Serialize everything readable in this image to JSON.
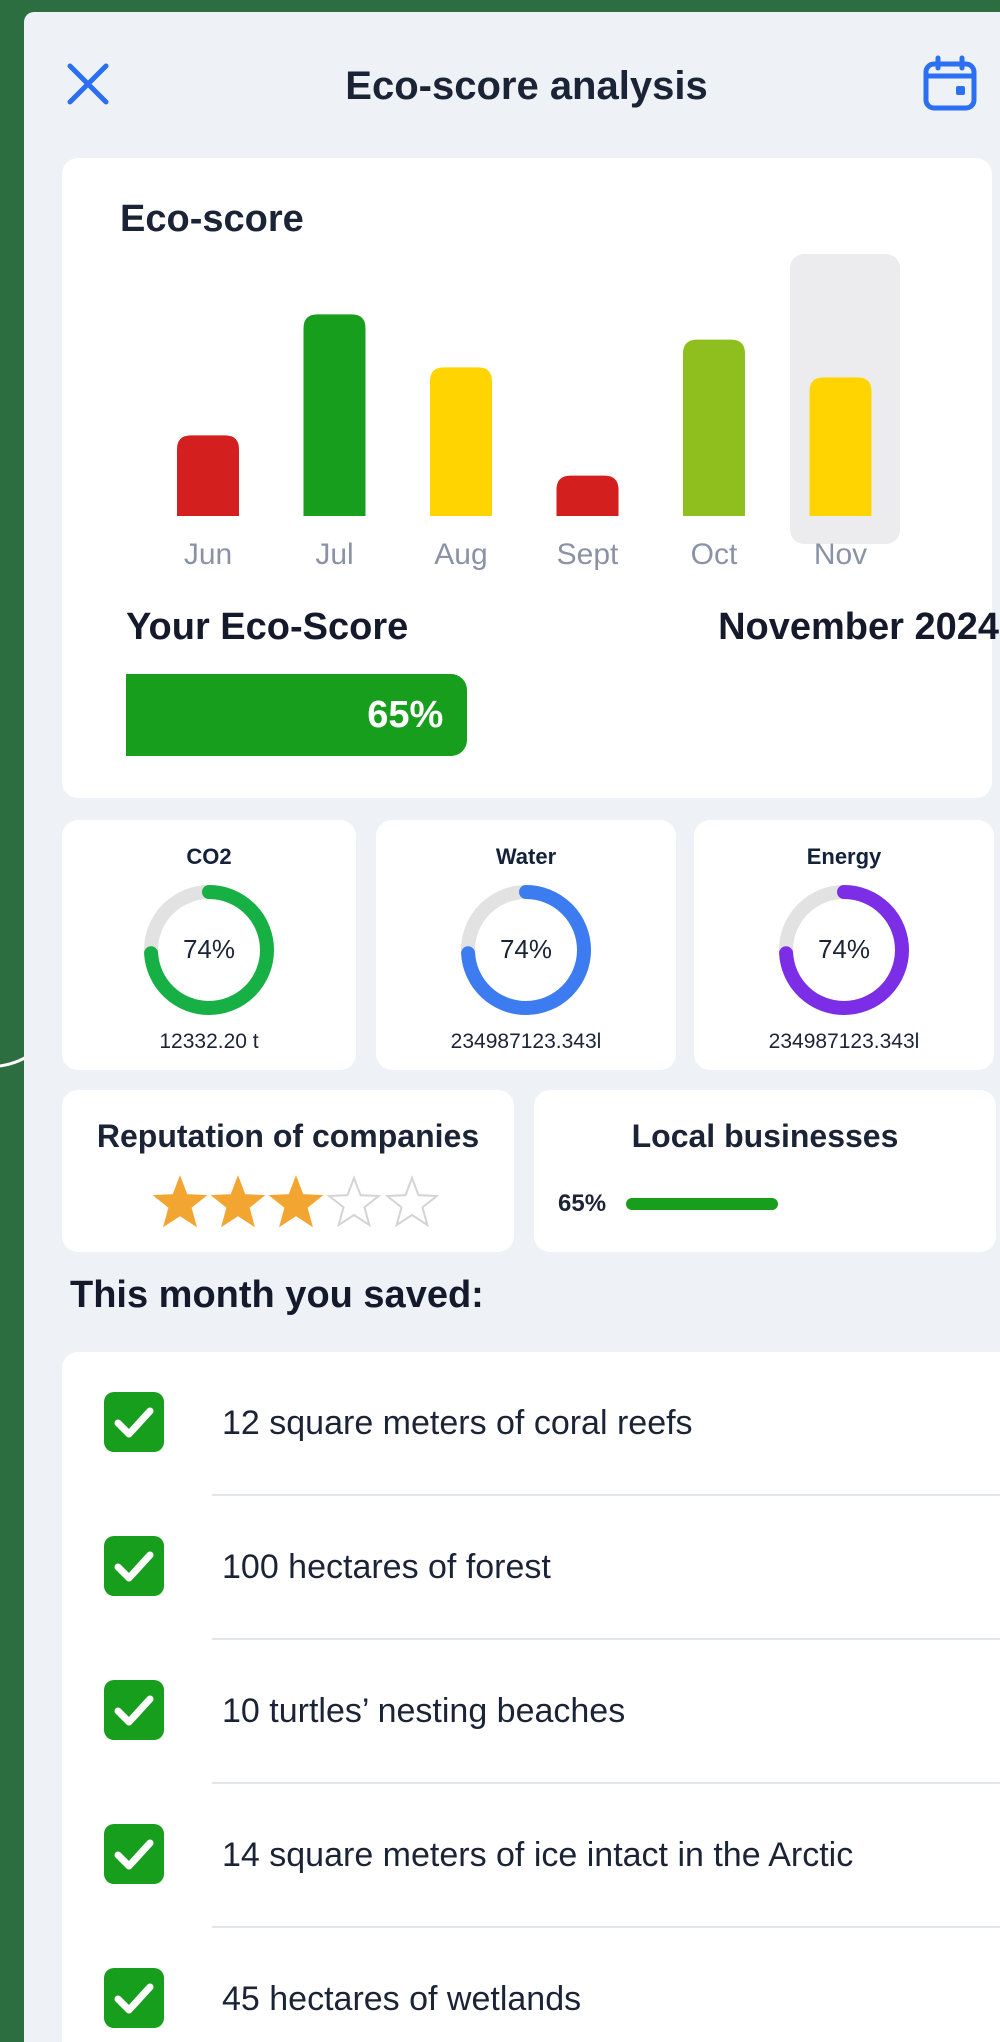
{
  "header": {
    "close_icon": "close-icon",
    "title": "Eco-score analysis",
    "calendar_icon": "calendar-icon"
  },
  "eco_card": {
    "label": "Eco-score",
    "selected_month": "Nov"
  },
  "chart_data": {
    "type": "bar",
    "categories": [
      "Jun",
      "Jul",
      "Aug",
      "Sept",
      "Oct",
      "Nov"
    ],
    "values": [
      32,
      80,
      59,
      16,
      70,
      55
    ],
    "colors": [
      "#d3201f",
      "#169e1c",
      "#ffd400",
      "#d3201f",
      "#8fbf1e",
      "#ffd400"
    ],
    "highlighted": "Nov",
    "title": "",
    "xlabel": "",
    "ylabel": "",
    "grid": false
  },
  "score": {
    "heading": "Your Eco-Score",
    "month": "November 2024",
    "percent_label": "65%",
    "percent": 65,
    "color": "#169e1c"
  },
  "metrics": [
    {
      "name": "CO2",
      "percent_label": "74%",
      "percent": 74,
      "value": "12332.20 t",
      "color": "#17b044"
    },
    {
      "name": "Water",
      "percent_label": "74%",
      "percent": 74,
      "value": "234987123.343l",
      "color": "#3d7cf0"
    },
    {
      "name": "Energy",
      "percent_label": "74%",
      "percent": 74,
      "value": "234987123.343l",
      "color": "#7b2ee6"
    }
  ],
  "reputation": {
    "title": "Reputation of companies",
    "rating": 3,
    "max_rating": 5,
    "star_icon": "star-icon"
  },
  "local": {
    "title": "Local businesses",
    "percent_label": "65%",
    "percent": 65
  },
  "saved": {
    "heading": "This month you saved:",
    "check_icon": "checkbox-checked-icon",
    "items": [
      "12 square meters of coral reefs",
      "100 hectares of forest",
      "10 turtles’ nesting beaches",
      "14 square meters of ice intact in the Arctic",
      "45 hectares of wetlands"
    ]
  }
}
